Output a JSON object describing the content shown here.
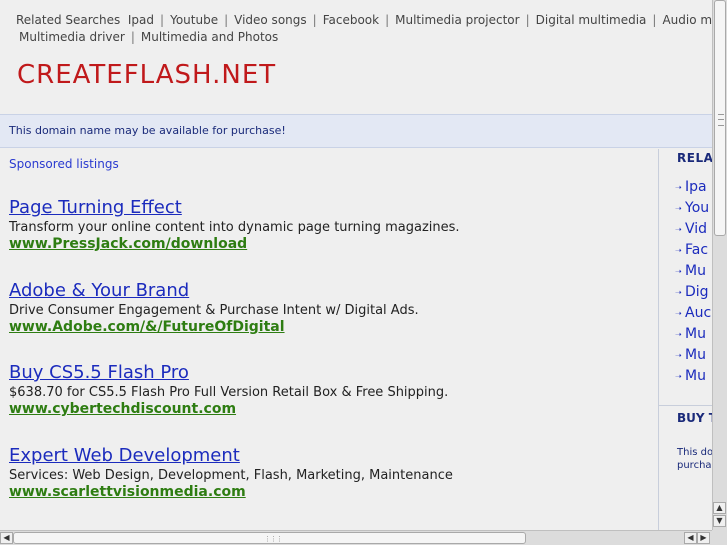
{
  "related": {
    "label": "Related Searches",
    "line1": [
      "Ipad",
      "Youtube",
      "Video songs",
      "Facebook",
      "Multimedia projector",
      "Digital multimedia",
      "Audio multimedia"
    ],
    "line2": [
      "Multimedia driver",
      "Multimedia and Photos"
    ]
  },
  "site": {
    "title": "CREATEFLASH.NET"
  },
  "domain_notice": "This domain name may be available for purchase!",
  "sponsored_label": "Sponsored listings",
  "listings": [
    {
      "title": "Page Turning Effect",
      "desc": "Transform your online content into dynamic page turning magazines.",
      "url": "www.PressJack.com/download"
    },
    {
      "title": "Adobe & Your Brand",
      "desc": "Drive Consumer Engagement & Purchase Intent w/ Digital Ads.",
      "url": "www.Adobe.com/&/FutureOfDigital"
    },
    {
      "title": "Buy CS5.5 Flash Pro",
      "desc": "$638.70 for CS5.5 Flash Pro Full Version Retail Box & Free Shipping.",
      "url": "www.cybertechdiscount.com"
    },
    {
      "title": "Expert Web Development",
      "desc": "Services: Web Design, Development, Flash, Marketing, Maintenance",
      "url": "www.scarlettvisionmedia.com"
    }
  ],
  "sidebar": {
    "heading": "RELA",
    "items": [
      "Ipa",
      "You",
      "Vid",
      "Fac",
      "Mu",
      "Dig",
      "Auc",
      "Mu",
      "Mu",
      "Mu"
    ],
    "buy_heading": "BUY T",
    "note_line1": "This do",
    "note_line2": "purcha"
  },
  "icons": {
    "bullet": "arrow-bullet-icon",
    "scroll_up": "up-arrow-icon",
    "scroll_down": "down-arrow-icon",
    "scroll_left": "left-arrow-icon",
    "scroll_right": "right-arrow-icon"
  },
  "colors": {
    "title_red": "#c0191b",
    "link_blue": "#1b2bbd",
    "url_green": "#2e7d12",
    "notice_bg": "#e3e8f4"
  }
}
